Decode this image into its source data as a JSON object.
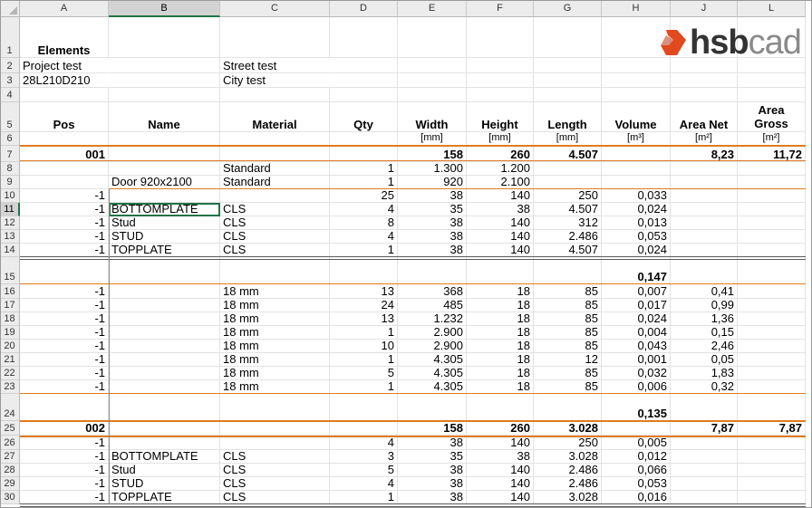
{
  "columns": [
    {
      "id": "A",
      "label": "A",
      "selected": false
    },
    {
      "id": "B",
      "label": "B",
      "selected": true
    },
    {
      "id": "C",
      "label": "C",
      "selected": false
    },
    {
      "id": "D",
      "label": "D",
      "selected": false
    },
    {
      "id": "E",
      "label": "E",
      "selected": false
    },
    {
      "id": "F",
      "label": "F",
      "selected": false
    },
    {
      "id": "G",
      "label": "G",
      "selected": false
    },
    {
      "id": "H",
      "label": "H",
      "selected": false
    },
    {
      "id": "J",
      "label": "J",
      "selected": false
    },
    {
      "id": "L",
      "label": "L",
      "selected": false
    }
  ],
  "selected_cell": "B11",
  "logo": {
    "part1": "hsb",
    "part2": "cad",
    "brand_color": "#e2491f"
  },
  "colors": {
    "accent_orange": "#e07b1f",
    "selection_green": "#217346",
    "double_rule": "#5a5a5a"
  },
  "rows": [
    {
      "n": "1",
      "cells": {
        "A": {
          "v": "Elements",
          "b": true,
          "a": "c"
        }
      }
    },
    {
      "n": "2",
      "cells": {
        "A": {
          "v": "Project test",
          "a": "l"
        },
        "C": {
          "v": "Street test",
          "a": "l"
        }
      }
    },
    {
      "n": "3",
      "cells": {
        "A": {
          "v": "28L210D210",
          "a": "l"
        },
        "C": {
          "v": "City test",
          "a": "l"
        }
      }
    },
    {
      "n": "4",
      "cells": {}
    },
    {
      "n": "5",
      "cells": {
        "A": {
          "v": "Pos",
          "b": true,
          "a": "c"
        },
        "B": {
          "v": "Name",
          "b": true,
          "a": "c"
        },
        "C": {
          "v": "Material",
          "b": true,
          "a": "c"
        },
        "D": {
          "v": "Qty",
          "b": true,
          "a": "c"
        },
        "E": {
          "v": "Width",
          "b": true,
          "a": "c"
        },
        "F": {
          "v": "Height",
          "b": true,
          "a": "c"
        },
        "G": {
          "v": "Length",
          "b": true,
          "a": "c"
        },
        "H": {
          "v": "Volume",
          "b": true,
          "a": "c"
        },
        "J": {
          "v": "Area Net",
          "b": true,
          "a": "c"
        },
        "L": {
          "v": "Area Gross",
          "b": true,
          "a": "c",
          "wrap": true
        }
      }
    },
    {
      "n": "6",
      "cells": {
        "E": {
          "v": "[mm]",
          "a": "c",
          "unit": true
        },
        "F": {
          "v": "[mm]",
          "a": "c",
          "unit": true
        },
        "G": {
          "v": "[mm]",
          "a": "c",
          "unit": true
        },
        "H": {
          "v": "[m³]",
          "a": "c",
          "unit": true
        },
        "J": {
          "v": "[m²]",
          "a": "c",
          "unit": true
        },
        "L": {
          "v": "[m²]",
          "a": "c",
          "unit": true
        }
      }
    },
    {
      "n": "7",
      "cells": {
        "A": {
          "v": "001",
          "b": true,
          "a": "r"
        },
        "E": {
          "v": "158",
          "b": true,
          "a": "r"
        },
        "F": {
          "v": "260",
          "b": true,
          "a": "r"
        },
        "G": {
          "v": "4.507",
          "b": true,
          "a": "r"
        },
        "J": {
          "v": "8,23",
          "b": true,
          "a": "r"
        },
        "L": {
          "v": "11,72",
          "b": true,
          "a": "r"
        }
      }
    },
    {
      "n": "8",
      "cells": {
        "C": {
          "v": "Standard",
          "a": "l"
        },
        "D": {
          "v": "1",
          "a": "r"
        },
        "E": {
          "v": "1.300",
          "a": "r"
        },
        "F": {
          "v": "1.200",
          "a": "r"
        }
      }
    },
    {
      "n": "9",
      "cells": {
        "B": {
          "v": "Door 920x2100",
          "a": "l"
        },
        "C": {
          "v": "Standard",
          "a": "l"
        },
        "D": {
          "v": "1",
          "a": "r"
        },
        "E": {
          "v": "920",
          "a": "r"
        },
        "F": {
          "v": "2.100",
          "a": "r"
        }
      }
    },
    {
      "n": "10",
      "cells": {
        "A": {
          "v": "-1",
          "a": "r"
        },
        "D": {
          "v": "25",
          "a": "r"
        },
        "E": {
          "v": "38",
          "a": "r"
        },
        "F": {
          "v": "140",
          "a": "r"
        },
        "G": {
          "v": "250",
          "a": "r"
        },
        "H": {
          "v": "0,033",
          "a": "r"
        }
      }
    },
    {
      "n": "11",
      "cells": {
        "A": {
          "v": "-1",
          "a": "r"
        },
        "B": {
          "v": "BOTTOMPLATE",
          "a": "l"
        },
        "C": {
          "v": "CLS",
          "a": "l"
        },
        "D": {
          "v": "4",
          "a": "r"
        },
        "E": {
          "v": "35",
          "a": "r"
        },
        "F": {
          "v": "38",
          "a": "r"
        },
        "G": {
          "v": "4.507",
          "a": "r"
        },
        "H": {
          "v": "0,024",
          "a": "r"
        }
      }
    },
    {
      "n": "12",
      "cells": {
        "A": {
          "v": "-1",
          "a": "r"
        },
        "B": {
          "v": "Stud",
          "a": "l"
        },
        "C": {
          "v": "CLS",
          "a": "l"
        },
        "D": {
          "v": "8",
          "a": "r"
        },
        "E": {
          "v": "38",
          "a": "r"
        },
        "F": {
          "v": "140",
          "a": "r"
        },
        "G": {
          "v": "312",
          "a": "r"
        },
        "H": {
          "v": "0,013",
          "a": "r"
        }
      }
    },
    {
      "n": "13",
      "cells": {
        "A": {
          "v": "-1",
          "a": "r"
        },
        "B": {
          "v": "STUD",
          "a": "l"
        },
        "C": {
          "v": "CLS",
          "a": "l"
        },
        "D": {
          "v": "4",
          "a": "r"
        },
        "E": {
          "v": "38",
          "a": "r"
        },
        "F": {
          "v": "140",
          "a": "r"
        },
        "G": {
          "v": "2.486",
          "a": "r"
        },
        "H": {
          "v": "0,053",
          "a": "r"
        }
      }
    },
    {
      "n": "14",
      "cells": {
        "A": {
          "v": "-1",
          "a": "r"
        },
        "B": {
          "v": "TOPPLATE",
          "a": "l"
        },
        "C": {
          "v": "CLS",
          "a": "l"
        },
        "D": {
          "v": "1",
          "a": "r"
        },
        "E": {
          "v": "38",
          "a": "r"
        },
        "F": {
          "v": "140",
          "a": "r"
        },
        "G": {
          "v": "4.507",
          "a": "r"
        },
        "H": {
          "v": "0,024",
          "a": "r"
        }
      }
    },
    {
      "n": "15",
      "cells": {
        "H": {
          "v": "0,147",
          "b": true,
          "a": "r"
        }
      }
    },
    {
      "n": "16",
      "cells": {
        "A": {
          "v": "-1",
          "a": "r"
        },
        "C": {
          "v": "18 mm",
          "a": "l"
        },
        "D": {
          "v": "13",
          "a": "r"
        },
        "E": {
          "v": "368",
          "a": "r"
        },
        "F": {
          "v": "18",
          "a": "r"
        },
        "G": {
          "v": "85",
          "a": "r"
        },
        "H": {
          "v": "0,007",
          "a": "r"
        },
        "J": {
          "v": "0,41",
          "a": "r"
        }
      }
    },
    {
      "n": "17",
      "cells": {
        "A": {
          "v": "-1",
          "a": "r"
        },
        "C": {
          "v": "18 mm",
          "a": "l"
        },
        "D": {
          "v": "24",
          "a": "r"
        },
        "E": {
          "v": "485",
          "a": "r"
        },
        "F": {
          "v": "18",
          "a": "r"
        },
        "G": {
          "v": "85",
          "a": "r"
        },
        "H": {
          "v": "0,017",
          "a": "r"
        },
        "J": {
          "v": "0,99",
          "a": "r"
        }
      }
    },
    {
      "n": "18",
      "cells": {
        "A": {
          "v": "-1",
          "a": "r"
        },
        "C": {
          "v": "18 mm",
          "a": "l"
        },
        "D": {
          "v": "13",
          "a": "r"
        },
        "E": {
          "v": "1.232",
          "a": "r"
        },
        "F": {
          "v": "18",
          "a": "r"
        },
        "G": {
          "v": "85",
          "a": "r"
        },
        "H": {
          "v": "0,024",
          "a": "r"
        },
        "J": {
          "v": "1,36",
          "a": "r"
        }
      }
    },
    {
      "n": "19",
      "cells": {
        "A": {
          "v": "-1",
          "a": "r"
        },
        "C": {
          "v": "18 mm",
          "a": "l"
        },
        "D": {
          "v": "1",
          "a": "r"
        },
        "E": {
          "v": "2.900",
          "a": "r"
        },
        "F": {
          "v": "18",
          "a": "r"
        },
        "G": {
          "v": "85",
          "a": "r"
        },
        "H": {
          "v": "0,004",
          "a": "r"
        },
        "J": {
          "v": "0,15",
          "a": "r"
        }
      }
    },
    {
      "n": "20",
      "cells": {
        "A": {
          "v": "-1",
          "a": "r"
        },
        "C": {
          "v": "18 mm",
          "a": "l"
        },
        "D": {
          "v": "10",
          "a": "r"
        },
        "E": {
          "v": "2.900",
          "a": "r"
        },
        "F": {
          "v": "18",
          "a": "r"
        },
        "G": {
          "v": "85",
          "a": "r"
        },
        "H": {
          "v": "0,043",
          "a": "r"
        },
        "J": {
          "v": "2,46",
          "a": "r"
        }
      }
    },
    {
      "n": "21",
      "cells": {
        "A": {
          "v": "-1",
          "a": "r"
        },
        "C": {
          "v": "18 mm",
          "a": "l"
        },
        "D": {
          "v": "1",
          "a": "r"
        },
        "E": {
          "v": "4.305",
          "a": "r"
        },
        "F": {
          "v": "18",
          "a": "r"
        },
        "G": {
          "v": "12",
          "a": "r"
        },
        "H": {
          "v": "0,001",
          "a": "r"
        },
        "J": {
          "v": "0,05",
          "a": "r"
        }
      }
    },
    {
      "n": "22",
      "cells": {
        "A": {
          "v": "-1",
          "a": "r"
        },
        "C": {
          "v": "18 mm",
          "a": "l"
        },
        "D": {
          "v": "5",
          "a": "r"
        },
        "E": {
          "v": "4.305",
          "a": "r"
        },
        "F": {
          "v": "18",
          "a": "r"
        },
        "G": {
          "v": "85",
          "a": "r"
        },
        "H": {
          "v": "0,032",
          "a": "r"
        },
        "J": {
          "v": "1,83",
          "a": "r"
        }
      }
    },
    {
      "n": "23",
      "cells": {
        "A": {
          "v": "-1",
          "a": "r"
        },
        "C": {
          "v": "18 mm",
          "a": "l"
        },
        "D": {
          "v": "1",
          "a": "r"
        },
        "E": {
          "v": "4.305",
          "a": "r"
        },
        "F": {
          "v": "18",
          "a": "r"
        },
        "G": {
          "v": "85",
          "a": "r"
        },
        "H": {
          "v": "0,006",
          "a": "r"
        },
        "J": {
          "v": "0,32",
          "a": "r"
        }
      }
    },
    {
      "n": "24",
      "cells": {
        "H": {
          "v": "0,135",
          "b": true,
          "a": "r"
        }
      }
    },
    {
      "n": "25",
      "cells": {
        "A": {
          "v": "002",
          "b": true,
          "a": "r"
        },
        "E": {
          "v": "158",
          "b": true,
          "a": "r"
        },
        "F": {
          "v": "260",
          "b": true,
          "a": "r"
        },
        "G": {
          "v": "3.028",
          "b": true,
          "a": "r"
        },
        "J": {
          "v": "7,87",
          "b": true,
          "a": "r"
        },
        "L": {
          "v": "7,87",
          "b": true,
          "a": "r"
        }
      }
    },
    {
      "n": "26",
      "cells": {
        "A": {
          "v": "-1",
          "a": "r"
        },
        "D": {
          "v": "4",
          "a": "r"
        },
        "E": {
          "v": "38",
          "a": "r"
        },
        "F": {
          "v": "140",
          "a": "r"
        },
        "G": {
          "v": "250",
          "a": "r"
        },
        "H": {
          "v": "0,005",
          "a": "r"
        }
      }
    },
    {
      "n": "27",
      "cells": {
        "A": {
          "v": "-1",
          "a": "r"
        },
        "B": {
          "v": "BOTTOMPLATE",
          "a": "l"
        },
        "C": {
          "v": "CLS",
          "a": "l"
        },
        "D": {
          "v": "3",
          "a": "r"
        },
        "E": {
          "v": "35",
          "a": "r"
        },
        "F": {
          "v": "38",
          "a": "r"
        },
        "G": {
          "v": "3.028",
          "a": "r"
        },
        "H": {
          "v": "0,012",
          "a": "r"
        }
      }
    },
    {
      "n": "28",
      "cells": {
        "A": {
          "v": "-1",
          "a": "r"
        },
        "B": {
          "v": "Stud",
          "a": "l"
        },
        "C": {
          "v": "CLS",
          "a": "l"
        },
        "D": {
          "v": "5",
          "a": "r"
        },
        "E": {
          "v": "38",
          "a": "r"
        },
        "F": {
          "v": "140",
          "a": "r"
        },
        "G": {
          "v": "2.486",
          "a": "r"
        },
        "H": {
          "v": "0,066",
          "a": "r"
        }
      }
    },
    {
      "n": "29",
      "cells": {
        "A": {
          "v": "-1",
          "a": "r"
        },
        "B": {
          "v": "STUD",
          "a": "l"
        },
        "C": {
          "v": "CLS",
          "a": "l"
        },
        "D": {
          "v": "4",
          "a": "r"
        },
        "E": {
          "v": "38",
          "a": "r"
        },
        "F": {
          "v": "140",
          "a": "r"
        },
        "G": {
          "v": "2.486",
          "a": "r"
        },
        "H": {
          "v": "0,053",
          "a": "r"
        }
      }
    },
    {
      "n": "30",
      "cells": {
        "A": {
          "v": "-1",
          "a": "r"
        },
        "B": {
          "v": "TOPPLATE",
          "a": "l"
        },
        "C": {
          "v": "CLS",
          "a": "l"
        },
        "D": {
          "v": "1",
          "a": "r"
        },
        "E": {
          "v": "38",
          "a": "r"
        },
        "F": {
          "v": "140",
          "a": "r"
        },
        "G": {
          "v": "3.028",
          "a": "r"
        },
        "H": {
          "v": "0,016",
          "a": "r"
        }
      }
    }
  ]
}
